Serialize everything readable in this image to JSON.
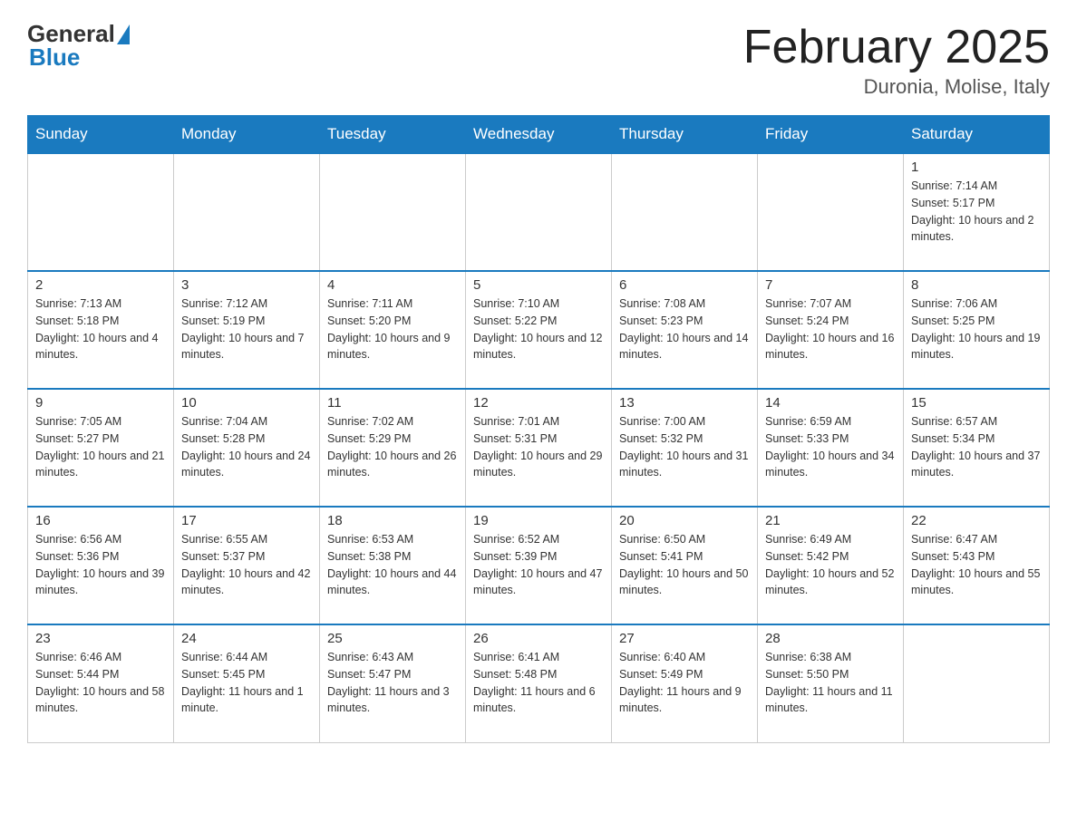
{
  "header": {
    "logo_general": "General",
    "logo_blue": "Blue",
    "month_title": "February 2025",
    "location": "Duronia, Molise, Italy"
  },
  "weekdays": [
    "Sunday",
    "Monday",
    "Tuesday",
    "Wednesday",
    "Thursday",
    "Friday",
    "Saturday"
  ],
  "weeks": [
    [
      {
        "day": "",
        "info": ""
      },
      {
        "day": "",
        "info": ""
      },
      {
        "day": "",
        "info": ""
      },
      {
        "day": "",
        "info": ""
      },
      {
        "day": "",
        "info": ""
      },
      {
        "day": "",
        "info": ""
      },
      {
        "day": "1",
        "info": "Sunrise: 7:14 AM\nSunset: 5:17 PM\nDaylight: 10 hours and 2 minutes."
      }
    ],
    [
      {
        "day": "2",
        "info": "Sunrise: 7:13 AM\nSunset: 5:18 PM\nDaylight: 10 hours and 4 minutes."
      },
      {
        "day": "3",
        "info": "Sunrise: 7:12 AM\nSunset: 5:19 PM\nDaylight: 10 hours and 7 minutes."
      },
      {
        "day": "4",
        "info": "Sunrise: 7:11 AM\nSunset: 5:20 PM\nDaylight: 10 hours and 9 minutes."
      },
      {
        "day": "5",
        "info": "Sunrise: 7:10 AM\nSunset: 5:22 PM\nDaylight: 10 hours and 12 minutes."
      },
      {
        "day": "6",
        "info": "Sunrise: 7:08 AM\nSunset: 5:23 PM\nDaylight: 10 hours and 14 minutes."
      },
      {
        "day": "7",
        "info": "Sunrise: 7:07 AM\nSunset: 5:24 PM\nDaylight: 10 hours and 16 minutes."
      },
      {
        "day": "8",
        "info": "Sunrise: 7:06 AM\nSunset: 5:25 PM\nDaylight: 10 hours and 19 minutes."
      }
    ],
    [
      {
        "day": "9",
        "info": "Sunrise: 7:05 AM\nSunset: 5:27 PM\nDaylight: 10 hours and 21 minutes."
      },
      {
        "day": "10",
        "info": "Sunrise: 7:04 AM\nSunset: 5:28 PM\nDaylight: 10 hours and 24 minutes."
      },
      {
        "day": "11",
        "info": "Sunrise: 7:02 AM\nSunset: 5:29 PM\nDaylight: 10 hours and 26 minutes."
      },
      {
        "day": "12",
        "info": "Sunrise: 7:01 AM\nSunset: 5:31 PM\nDaylight: 10 hours and 29 minutes."
      },
      {
        "day": "13",
        "info": "Sunrise: 7:00 AM\nSunset: 5:32 PM\nDaylight: 10 hours and 31 minutes."
      },
      {
        "day": "14",
        "info": "Sunrise: 6:59 AM\nSunset: 5:33 PM\nDaylight: 10 hours and 34 minutes."
      },
      {
        "day": "15",
        "info": "Sunrise: 6:57 AM\nSunset: 5:34 PM\nDaylight: 10 hours and 37 minutes."
      }
    ],
    [
      {
        "day": "16",
        "info": "Sunrise: 6:56 AM\nSunset: 5:36 PM\nDaylight: 10 hours and 39 minutes."
      },
      {
        "day": "17",
        "info": "Sunrise: 6:55 AM\nSunset: 5:37 PM\nDaylight: 10 hours and 42 minutes."
      },
      {
        "day": "18",
        "info": "Sunrise: 6:53 AM\nSunset: 5:38 PM\nDaylight: 10 hours and 44 minutes."
      },
      {
        "day": "19",
        "info": "Sunrise: 6:52 AM\nSunset: 5:39 PM\nDaylight: 10 hours and 47 minutes."
      },
      {
        "day": "20",
        "info": "Sunrise: 6:50 AM\nSunset: 5:41 PM\nDaylight: 10 hours and 50 minutes."
      },
      {
        "day": "21",
        "info": "Sunrise: 6:49 AM\nSunset: 5:42 PM\nDaylight: 10 hours and 52 minutes."
      },
      {
        "day": "22",
        "info": "Sunrise: 6:47 AM\nSunset: 5:43 PM\nDaylight: 10 hours and 55 minutes."
      }
    ],
    [
      {
        "day": "23",
        "info": "Sunrise: 6:46 AM\nSunset: 5:44 PM\nDaylight: 10 hours and 58 minutes."
      },
      {
        "day": "24",
        "info": "Sunrise: 6:44 AM\nSunset: 5:45 PM\nDaylight: 11 hours and 1 minute."
      },
      {
        "day": "25",
        "info": "Sunrise: 6:43 AM\nSunset: 5:47 PM\nDaylight: 11 hours and 3 minutes."
      },
      {
        "day": "26",
        "info": "Sunrise: 6:41 AM\nSunset: 5:48 PM\nDaylight: 11 hours and 6 minutes."
      },
      {
        "day": "27",
        "info": "Sunrise: 6:40 AM\nSunset: 5:49 PM\nDaylight: 11 hours and 9 minutes."
      },
      {
        "day": "28",
        "info": "Sunrise: 6:38 AM\nSunset: 5:50 PM\nDaylight: 11 hours and 11 minutes."
      },
      {
        "day": "",
        "info": ""
      }
    ]
  ]
}
